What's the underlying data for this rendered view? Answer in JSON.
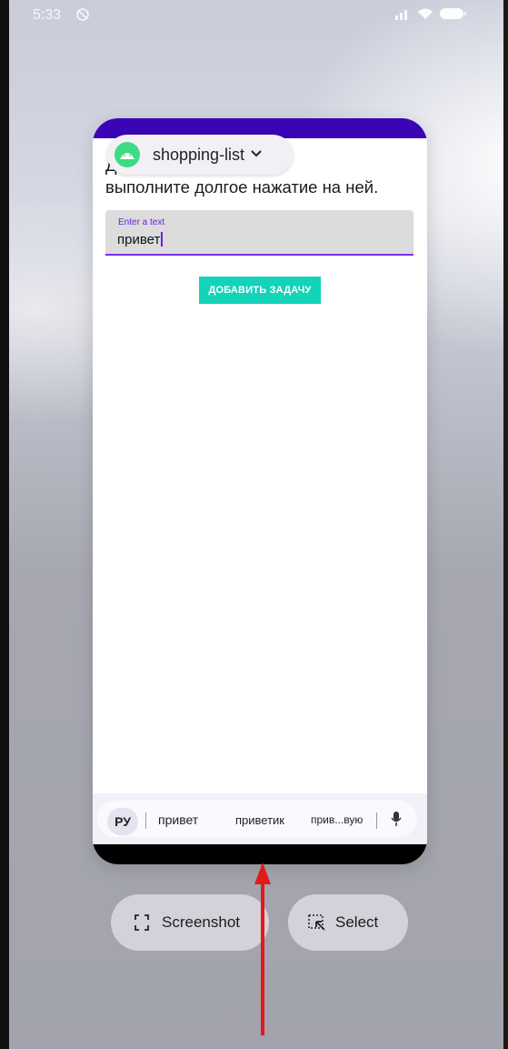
{
  "status_bar": {
    "time": "5:33"
  },
  "app": {
    "name": "shopping-list",
    "instruction_line1": "Для удаления задачи",
    "instruction_line2": "выполните долгое нажатие на ней.",
    "text_field": {
      "label": "Enter a text",
      "value": "привет"
    },
    "add_button_label": "ДОБАВИТЬ ЗАДАЧУ",
    "colors": {
      "top_bar": "#3a06b5",
      "button": "#13d3b9",
      "field_accent": "#7b2ff2"
    }
  },
  "keyboard_suggestions": {
    "language": "РУ",
    "items": [
      "привет",
      "приветик",
      "прив...вую"
    ]
  },
  "actions": {
    "screenshot_label": "Screenshot",
    "select_label": "Select"
  },
  "annotation": {
    "arrow_color": "#e11a1a"
  }
}
